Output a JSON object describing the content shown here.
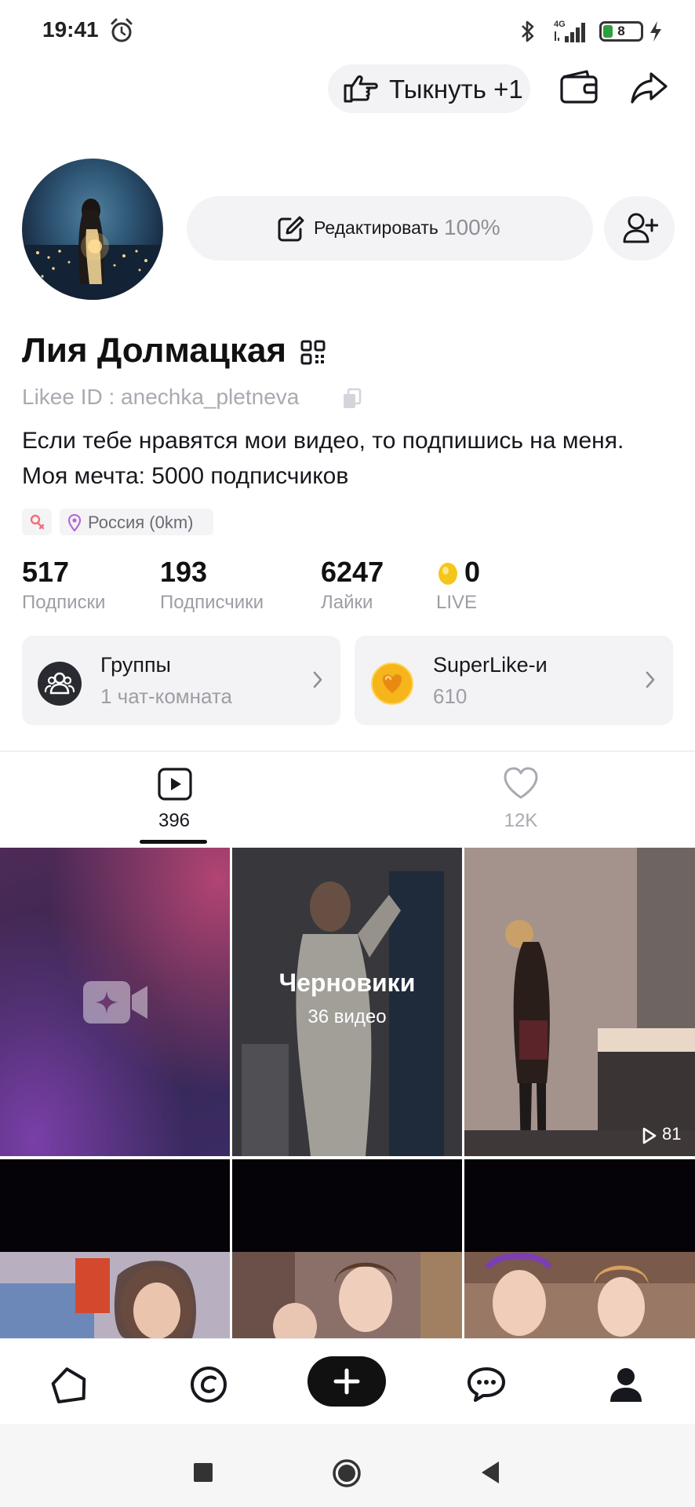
{
  "status_bar": {
    "time": "19:41",
    "network": "4G",
    "battery": "8"
  },
  "top_actions": {
    "poke_label": "Тыкнуть +1"
  },
  "profile": {
    "edit_label": "Редактировать",
    "edit_progress": "100%",
    "name": "Лия Долмацкая",
    "likee_id": "Likee ID : anechka_pletneva",
    "bio_line_1": "Если тебе нравятся мои видео, то подпишись на меня.",
    "bio_line_2": "Моя мечта: 5000 подписчиков",
    "location": "Россия (0km)"
  },
  "stats": [
    {
      "value": "517",
      "label": "Подписки"
    },
    {
      "value": "193",
      "label": "Подписчики"
    },
    {
      "value": "6247",
      "label": "Лайки"
    },
    {
      "value": "0",
      "label": "LIVE"
    }
  ],
  "cards": {
    "groups": {
      "title": "Группы",
      "subtitle": "1 чат-комната"
    },
    "superlikes": {
      "title": "SuperLike-и",
      "subtitle": "610"
    }
  },
  "tabs": {
    "videos_count": "396",
    "likes_count": "12K"
  },
  "grid": {
    "drafts_title": "Черновики",
    "drafts_count": "36 видео",
    "video_1_views": "81"
  },
  "colors": {
    "accent_dark": "#111111",
    "card_bg": "#f3f3f5",
    "muted_text": "#9d9ea5",
    "superlike_yellow": "#f6b51a",
    "location_pin": "#b36bd6",
    "gender_tag": "#f0707a"
  },
  "icons": {
    "alarm": "alarm-icon",
    "bluetooth": "bluetooth-icon",
    "poke": "pointing-hand-icon",
    "wallet": "wallet-icon",
    "share": "share-arrow-icon",
    "edit": "edit-pencil-icon",
    "add_friend": "add-user-icon",
    "qr": "qr-code-icon",
    "copy": "copy-icon",
    "home": "home-icon",
    "explore": "explore-icon",
    "create": "plus-icon",
    "messages": "chat-bubble-icon",
    "profile": "profile-icon"
  }
}
